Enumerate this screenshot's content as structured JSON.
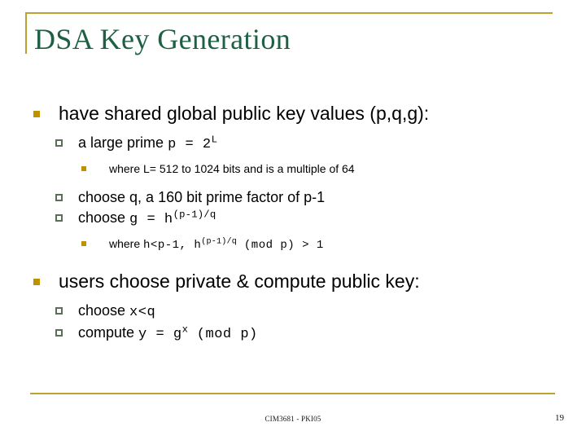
{
  "slide": {
    "title": "DSA Key Generation",
    "title_color": "#1d6044",
    "accent_color": "#bfa12f",
    "bullet_level1_color": "#bf9000",
    "bullet_level2_color": "#5a6e58",
    "bullet_level3_color": "#bf9000",
    "background_color": "#ffffff"
  },
  "content": {
    "b1": {
      "text": "have shared global public key values (p,q,g):"
    },
    "b1s1": {
      "text": "a large prime ",
      "mono": "p = 2",
      "sup": "L"
    },
    "b1s1s1": {
      "text": "where L= 512 to 1024 bits and is a multiple of 64"
    },
    "b1s2": {
      "text": "choose q, a 160 bit prime factor of p-1"
    },
    "b1s3": {
      "text": "choose ",
      "mono": "g = h",
      "sup": "(p-1)/q"
    },
    "b1s3s1": {
      "text": "where ",
      "mono_a": "h<p-1, h",
      "sup": "(p-1)/q",
      "mono_b": " (mod p) > 1"
    },
    "b2": {
      "text": "users choose private & compute public key:"
    },
    "b2s1": {
      "text": "choose ",
      "mono": "x<q"
    },
    "b2s2": {
      "text": "compute ",
      "mono_a": "y = g",
      "sup": "x",
      "mono_b": " (mod p)"
    }
  },
  "footer": {
    "center_label": "CIM3681 - PKI05",
    "page_number": "19"
  }
}
